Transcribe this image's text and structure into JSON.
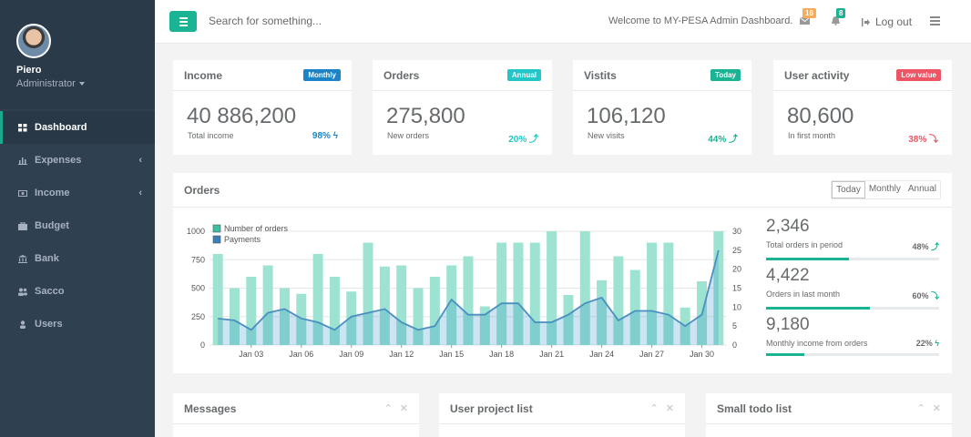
{
  "profile": {
    "name": "Piero",
    "role": "Administrator"
  },
  "nav": [
    {
      "label": "Dashboard",
      "icon": "grid-icon",
      "active": true
    },
    {
      "label": "Expenses",
      "icon": "bar-chart-icon",
      "arrow": "‹"
    },
    {
      "label": "Income",
      "icon": "money-icon",
      "arrow": "‹"
    },
    {
      "label": "Budget",
      "icon": "briefcase-icon"
    },
    {
      "label": "Bank",
      "icon": "bank-icon"
    },
    {
      "label": "Sacco",
      "icon": "users-icon"
    },
    {
      "label": "Users",
      "icon": "user-icon"
    }
  ],
  "topbar": {
    "search_placeholder": "Search for something...",
    "welcome": "Welcome to MY-PESA Admin Dashboard.",
    "messages_count": "16",
    "alerts_count": "8",
    "logout": "Log out"
  },
  "colors": {
    "accent": "#1ab394",
    "sidebar": "#2f4050",
    "blue": "#1c84c6",
    "info": "#23c6c8",
    "danger": "#ed5565",
    "warning": "#f8ac59"
  },
  "cards": [
    {
      "title": "Income",
      "badge": "Monthly",
      "badge_color": "#1c84c6",
      "value": "40 886,200",
      "sub": "Total income",
      "pct": "98%",
      "arrow": "ϟ",
      "pct_color": "#1c84c6"
    },
    {
      "title": "Orders",
      "badge": "Annual",
      "badge_color": "#23c6c8",
      "value": "275,800",
      "sub": "New orders",
      "pct": "20%",
      "arrow": "⤴",
      "pct_color": "#23c6c8"
    },
    {
      "title": "Vistits",
      "badge": "Today",
      "badge_color": "#1ab394",
      "value": "106,120",
      "sub": "New visits",
      "pct": "44%",
      "arrow": "⤴",
      "pct_color": "#1ab394"
    },
    {
      "title": "User activity",
      "badge": "Low value",
      "badge_color": "#ed5565",
      "value": "80,600",
      "sub": "In first month",
      "pct": "38%",
      "arrow": "⤵",
      "pct_color": "#ed5565"
    }
  ],
  "orders_panel": {
    "title": "Orders",
    "tabs": [
      "Today",
      "Monthly",
      "Annual"
    ],
    "stats": [
      {
        "value": "2,346",
        "label": "Total orders in period",
        "pct": "48%",
        "arrow": "⤴",
        "progress": 0.48
      },
      {
        "value": "4,422",
        "label": "Orders in last month",
        "pct": "60%",
        "arrow": "⤵",
        "progress": 0.6
      },
      {
        "value": "9,180",
        "label": "Monthly income from orders",
        "pct": "22%",
        "arrow": "ϟ",
        "progress": 0.22
      }
    ]
  },
  "chart_data": {
    "type": "bar",
    "x": [
      "Jan 01",
      "Jan 02",
      "Jan 03",
      "Jan 04",
      "Jan 05",
      "Jan 06",
      "Jan 07",
      "Jan 08",
      "Jan 09",
      "Jan 10",
      "Jan 11",
      "Jan 12",
      "Jan 13",
      "Jan 14",
      "Jan 15",
      "Jan 16",
      "Jan 17",
      "Jan 18",
      "Jan 19",
      "Jan 20",
      "Jan 21",
      "Jan 22",
      "Jan 23",
      "Jan 24",
      "Jan 25",
      "Jan 26",
      "Jan 27",
      "Jan 28",
      "Jan 29",
      "Jan 30",
      "Jan 31"
    ],
    "xticks": [
      "Jan 03",
      "Jan 06",
      "Jan 09",
      "Jan 12",
      "Jan 15",
      "Jan 18",
      "Jan 21",
      "Jan 24",
      "Jan 27",
      "Jan 30"
    ],
    "series": [
      {
        "name": "Number of orders",
        "kind": "bar",
        "axis": "left",
        "color": "#9ee3d2",
        "values": [
          800,
          500,
          600,
          700,
          500,
          450,
          800,
          600,
          470,
          900,
          690,
          700,
          500,
          600,
          700,
          780,
          340,
          900,
          900,
          900,
          1000,
          440,
          1000,
          570,
          780,
          660,
          900,
          900,
          330,
          560,
          1000
        ]
      },
      {
        "name": "Payments",
        "kind": "area",
        "axis": "right",
        "color": "#1c84c6",
        "values": [
          7,
          6.5,
          4,
          8.5,
          9.5,
          7,
          6,
          4,
          7.5,
          8.5,
          9.5,
          6,
          4,
          5,
          12,
          8,
          8,
          11,
          11,
          6,
          6,
          8,
          11,
          12.5,
          6.5,
          9,
          9,
          8,
          5,
          8,
          25
        ]
      }
    ],
    "left_ylim": [
      0,
      1000
    ],
    "left_ticks": [
      "0",
      "250",
      "500",
      "750",
      "1000"
    ],
    "right_ylim": [
      0,
      30
    ],
    "right_ticks": [
      "0",
      "5",
      "10",
      "15",
      "20",
      "25",
      "30"
    ],
    "legend_position": "top-left",
    "grid": true
  },
  "bottom_panels": [
    {
      "title": "Messages"
    },
    {
      "title": "User project list"
    },
    {
      "title": "Small todo list"
    }
  ]
}
